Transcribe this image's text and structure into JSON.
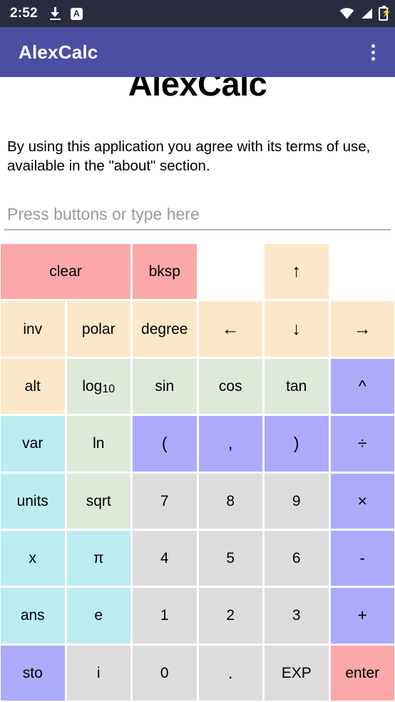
{
  "statusbar": {
    "time": "2:52",
    "left_icons": [
      {
        "name": "download-icon"
      },
      {
        "name": "app-badge-a-icon",
        "label": "A"
      }
    ],
    "right_icons": [
      {
        "name": "wifi-icon"
      },
      {
        "name": "cellular-signal-icon"
      },
      {
        "name": "battery-charging-icon",
        "glyph": "⚡"
      }
    ]
  },
  "appbar": {
    "title": "AlexCalc",
    "overflow_menu": "overflow-menu"
  },
  "main": {
    "heading": "AlexCalc",
    "disclaimer": "By using this application you agree with its terms of use, available in the \"about\" section.",
    "input": {
      "value": "",
      "placeholder": "Press buttons or type here"
    }
  },
  "colors": {
    "status_bar": "#2b2b40",
    "app_bar": "#4c4ea3",
    "pink": "#fda8a8",
    "cream": "#fce8c8",
    "green": "#dee9da",
    "cyan": "#bcecf0",
    "purple": "#aeaafb",
    "gray": "#dcdcdc",
    "page": "#ffffff"
  },
  "keypad": {
    "rows": [
      [
        {
          "label": "clear",
          "name": "key-clear",
          "color": "pink",
          "span": 2
        },
        {
          "label": "bksp",
          "name": "key-bksp",
          "color": "pink"
        },
        {
          "label": "",
          "name": "key-empty",
          "color": "none",
          "empty": true
        },
        {
          "label": "↑",
          "name": "key-cursor-up",
          "color": "cream",
          "arrow": true
        },
        {
          "label": "",
          "name": "key-empty",
          "color": "none",
          "empty": true
        }
      ],
      [
        {
          "label": "inv",
          "name": "key-inv",
          "color": "cream"
        },
        {
          "label": "polar",
          "name": "key-polar",
          "color": "cream"
        },
        {
          "label": "degree",
          "name": "key-degree",
          "color": "cream"
        },
        {
          "label": "←",
          "name": "key-cursor-left",
          "color": "cream",
          "arrow": true
        },
        {
          "label": "↓",
          "name": "key-cursor-down",
          "color": "cream",
          "arrow": true
        },
        {
          "label": "→",
          "name": "key-cursor-right",
          "color": "cream",
          "arrow": true
        }
      ],
      [
        {
          "label": "alt",
          "name": "key-alt",
          "color": "cream"
        },
        {
          "label": "log",
          "sub": "10",
          "name": "key-log10",
          "color": "green"
        },
        {
          "label": "sin",
          "name": "key-sin",
          "color": "green"
        },
        {
          "label": "cos",
          "name": "key-cos",
          "color": "green"
        },
        {
          "label": "tan",
          "name": "key-tan",
          "color": "green"
        },
        {
          "label": "^",
          "name": "key-power",
          "color": "purple",
          "sym": true
        }
      ],
      [
        {
          "label": "var",
          "name": "key-var",
          "color": "cyan"
        },
        {
          "label": "ln",
          "name": "key-ln",
          "color": "green"
        },
        {
          "label": "(",
          "name": "key-open-paren",
          "color": "purple",
          "sym": true
        },
        {
          "label": ",",
          "name": "key-comma",
          "color": "purple",
          "sym": true
        },
        {
          "label": ")",
          "name": "key-close-paren",
          "color": "purple",
          "sym": true
        },
        {
          "label": "÷",
          "name": "key-divide",
          "color": "purple",
          "sym": true
        }
      ],
      [
        {
          "label": "units",
          "name": "key-units",
          "color": "cyan"
        },
        {
          "label": "sqrt",
          "name": "key-sqrt",
          "color": "green"
        },
        {
          "label": "7",
          "name": "key-7",
          "color": "gray"
        },
        {
          "label": "8",
          "name": "key-8",
          "color": "gray"
        },
        {
          "label": "9",
          "name": "key-9",
          "color": "gray"
        },
        {
          "label": "×",
          "name": "key-multiply",
          "color": "purple",
          "sym": true
        }
      ],
      [
        {
          "label": "x",
          "name": "key-x",
          "color": "cyan"
        },
        {
          "label": "π",
          "name": "key-pi",
          "color": "cyan"
        },
        {
          "label": "4",
          "name": "key-4",
          "color": "gray"
        },
        {
          "label": "5",
          "name": "key-5",
          "color": "gray"
        },
        {
          "label": "6",
          "name": "key-6",
          "color": "gray"
        },
        {
          "label": "-",
          "name": "key-minus",
          "color": "purple",
          "sym": true
        }
      ],
      [
        {
          "label": "ans",
          "name": "key-ans",
          "color": "cyan"
        },
        {
          "label": "e",
          "name": "key-e",
          "color": "cyan"
        },
        {
          "label": "1",
          "name": "key-1",
          "color": "gray"
        },
        {
          "label": "2",
          "name": "key-2",
          "color": "gray"
        },
        {
          "label": "3",
          "name": "key-3",
          "color": "gray"
        },
        {
          "label": "+",
          "name": "key-plus",
          "color": "purple",
          "sym": true
        }
      ],
      [
        {
          "label": "sto",
          "name": "key-sto",
          "color": "purple"
        },
        {
          "label": "i",
          "name": "key-i",
          "color": "gray"
        },
        {
          "label": "0",
          "name": "key-0",
          "color": "gray"
        },
        {
          "label": ".",
          "name": "key-decimal-point",
          "color": "gray",
          "sym": true
        },
        {
          "label": "EXP",
          "name": "key-exp",
          "color": "gray"
        },
        {
          "label": "enter",
          "name": "key-enter",
          "color": "pink"
        }
      ]
    ]
  }
}
